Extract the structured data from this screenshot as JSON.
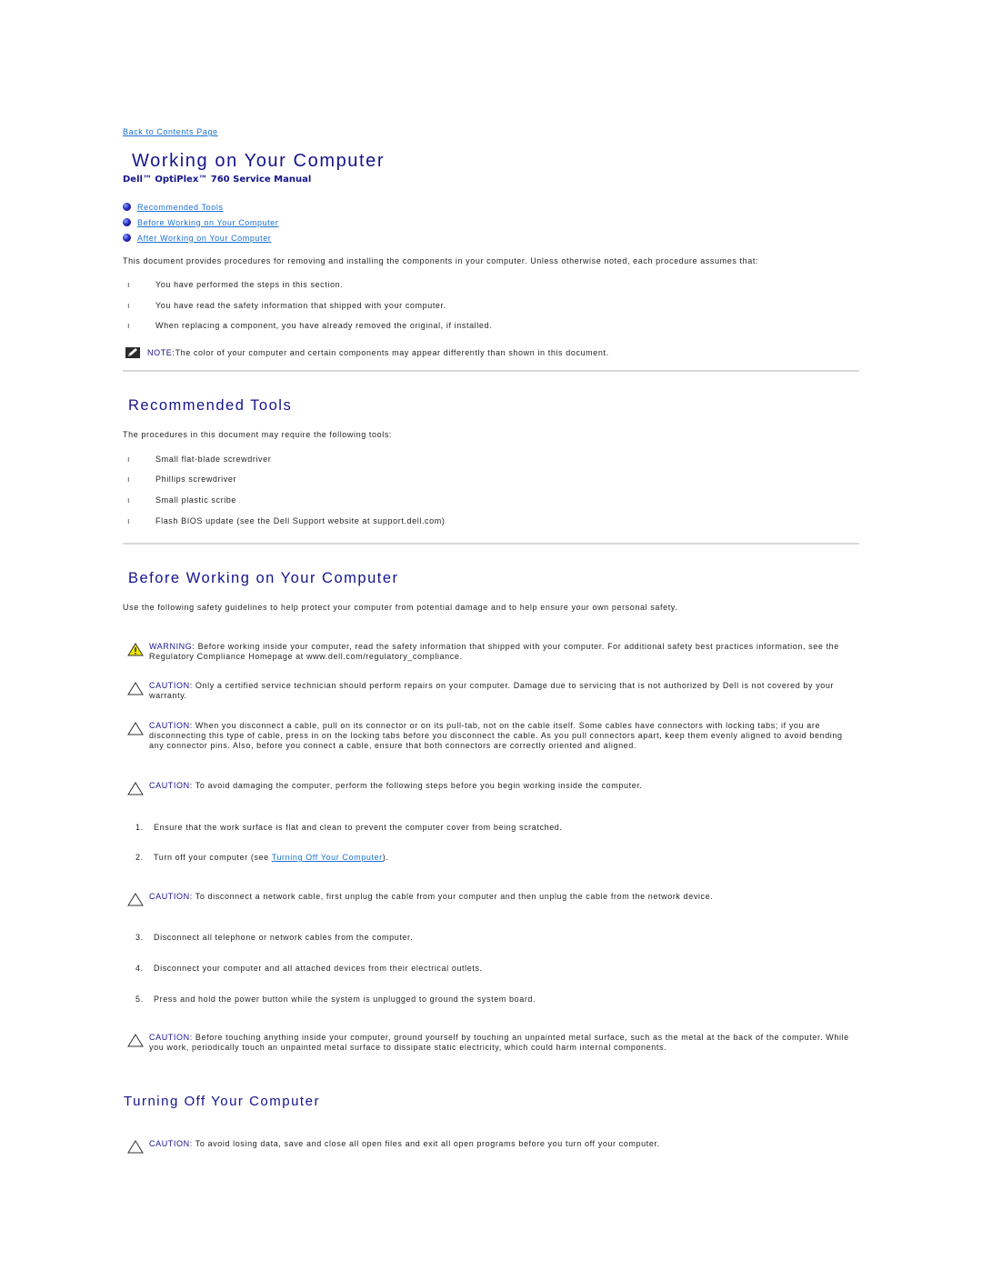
{
  "nav": {
    "back_link": "Back to Contents Page"
  },
  "header": {
    "title": "Working on Your Computer",
    "subtitle": "Dell™ OptiPlex™ 760 Service Manual"
  },
  "toc": [
    {
      "label": "Recommended Tools"
    },
    {
      "label": "Before Working on Your Computer"
    },
    {
      "label": "After Working on Your Computer"
    }
  ],
  "intro": {
    "text": "This document provides procedures for removing and installing the components in your computer. Unless otherwise noted, each procedure assumes that:",
    "assumptions": [
      "You have performed the steps in this section.",
      "You have read the safety information that shipped with your computer.",
      "When replacing a component, you have already removed the original, if installed."
    ],
    "note": {
      "label": "NOTE:",
      "text": " The color of your computer and certain components may appear differently than shown in this document."
    }
  },
  "recommended_tools": {
    "heading": "Recommended Tools",
    "intro": "The procedures in this document may require the following tools:",
    "items": [
      "Small flat-blade screwdriver",
      "Phillips screwdriver",
      "Small plastic scribe",
      "Flash BIOS update (see the Dell Support website at support.dell.com)"
    ]
  },
  "before_working": {
    "heading": "Before Working on Your Computer",
    "intro": "Use the following safety guidelines to help protect your computer from potential damage and to help ensure your own personal safety.",
    "warning": {
      "label": "WARNING:",
      "text": " Before working inside your computer, read the safety information that shipped with your computer. For additional safety best practices information, see the Regulatory Compliance Homepage at www.dell.com/regulatory_compliance."
    },
    "cautions": [
      {
        "label": "CAUTION:",
        "text": " Only a certified service technician should perform repairs on your computer. Damage due to servicing that is not authorized by Dell is not covered by your warranty."
      },
      {
        "label": "CAUTION:",
        "text": " When you disconnect a cable, pull on its connector or on its pull-tab, not on the cable itself. Some cables have connectors with locking tabs; if you are disconnecting this type of cable, press in on the locking tabs before you disconnect the cable. As you pull connectors apart, keep them evenly aligned to avoid bending any connector pins. Also, before you connect a cable, ensure that both connectors are correctly oriented and aligned."
      },
      {
        "label": "CAUTION:",
        "text": " To avoid damaging the computer, perform the following steps before you begin working inside the computer."
      }
    ],
    "steps": [
      {
        "num": "1.",
        "text": "Ensure that the work surface is flat and clean to prevent the computer cover from being scratched."
      },
      {
        "num": "2.",
        "text_before": "Turn off your computer (see ",
        "link": "Turning Off Your Computer",
        "text_after": ")."
      },
      {
        "num": "3.",
        "text": "Disconnect all telephone or network cables from the computer."
      },
      {
        "num": "4.",
        "text": "Disconnect your computer and all attached devices from their electrical outlets."
      },
      {
        "num": "5.",
        "text": "Press and hold the power button while the system is unplugged to ground the system board."
      }
    ],
    "network_caution": {
      "label": "CAUTION:",
      "text": " To disconnect a network cable, first unplug the cable from your computer and then unplug the cable from the network device."
    },
    "ground_caution": {
      "label": "CAUTION:",
      "text": " Before touching anything inside your computer, ground yourself by touching an unpainted metal surface, such as the metal at the back of the computer. While you work, periodically touch an unpainted metal surface to dissipate static electricity, which could harm internal components."
    }
  },
  "turning_off": {
    "heading": "Turning Off Your Computer",
    "caution": {
      "label": "CAUTION:",
      "text": " To avoid losing data, save and close all open files and exit all open programs before you turn off your computer."
    }
  },
  "colors": {
    "heading": "#14148c",
    "link": "#1a6fd1",
    "rule": "#d9d9d9"
  }
}
